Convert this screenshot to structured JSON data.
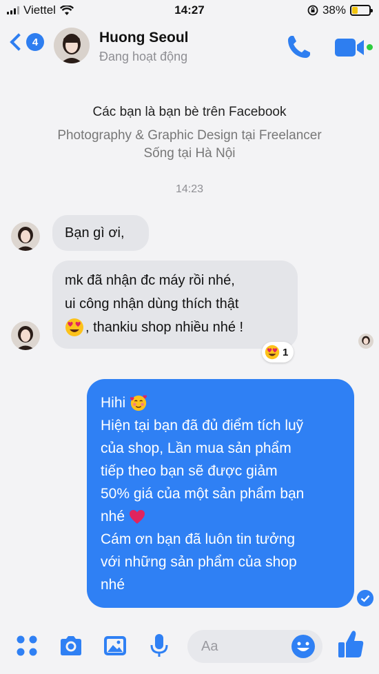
{
  "status_bar": {
    "carrier": "Viettel",
    "time": "14:27",
    "battery": "38%",
    "battery_level": 0.38
  },
  "header": {
    "back_badge": "4",
    "name": "Huong Seoul",
    "status": "Đang hoạt động"
  },
  "intro": {
    "friends": "Các bạn là bạn bè trên Facebook",
    "work": "Photography & Graphic Design tại Freelancer",
    "home": "Sống tại Hà Nội"
  },
  "timestamp": "14:23",
  "messages": {
    "incoming_1": "Bạn gì ơi,",
    "incoming_2_line1": "mk đã nhận đc máy rồi nhé,",
    "incoming_2_line2": "ui công nhận dùng thích thật",
    "incoming_2_line3": ", thankiu shop nhiều nhé !",
    "reaction_count": "1",
    "outgoing_line1": "Hihi",
    "outgoing_line2": "Hiện tại bạn đã đủ điểm tích luỹ",
    "outgoing_line3": "của shop, Lần mua sản phẩm",
    "outgoing_line4": "tiếp theo bạn sẽ được giảm",
    "outgoing_line5": "50% giá của một sản phẩm bạn",
    "outgoing_line6": "nhé",
    "outgoing_line7": "Cám ơn bạn đã luôn tin tưởng",
    "outgoing_line8": "với những sản phẩm của shop",
    "outgoing_line9": "nhé"
  },
  "composer": {
    "placeholder": "Aa"
  },
  "colors": {
    "accent": "#2f80f4",
    "incoming_bubble": "#e4e5e9",
    "online": "#2ecc40"
  },
  "icons": [
    "wifi-icon",
    "back-chevron-icon",
    "phone-icon",
    "video-camera-icon",
    "heart-eyes-emoji-icon",
    "smiling-hearts-emoji-icon",
    "red-heart-emoji-icon",
    "delivered-check-icon",
    "menu-dots-icon",
    "camera-icon",
    "image-icon",
    "microphone-icon",
    "smiley-icon",
    "thumbs-up-icon"
  ]
}
